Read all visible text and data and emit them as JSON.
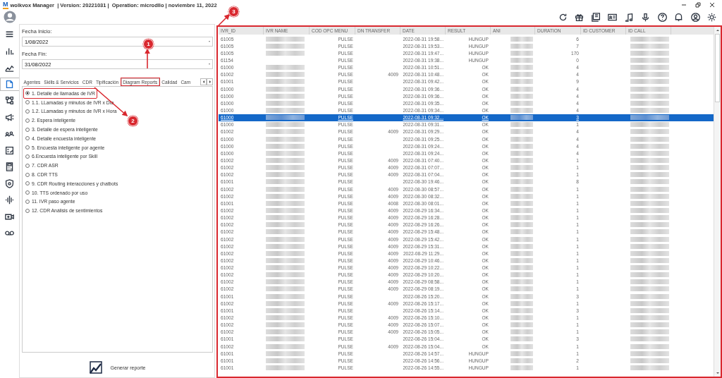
{
  "window": {
    "logo": "M",
    "title": "wolkvox Manager  | Version: 20221031 |  Operation: microdllo | noviembre 11, 2022"
  },
  "sidebar": {
    "items": [
      {
        "selected": false
      },
      {
        "selected": false
      },
      {
        "selected": false
      },
      {
        "selected": true
      },
      {
        "selected": false
      },
      {
        "selected": false
      },
      {
        "selected": false
      },
      {
        "selected": false
      },
      {
        "selected": false
      },
      {
        "selected": false
      },
      {
        "selected": false
      },
      {
        "selected": false
      },
      {
        "selected": false
      }
    ]
  },
  "filters": {
    "start_label": "Fecha Inicio:",
    "start_value": "1/08/2022",
    "end_label": "Fecha Fin:",
    "end_value": "31/08/2022"
  },
  "tabs": [
    {
      "label": "Agentes",
      "selected": false,
      "annotated": false
    },
    {
      "label": "Skills & Servicios",
      "selected": false,
      "annotated": false
    },
    {
      "label": "CDR",
      "selected": false,
      "annotated": false
    },
    {
      "label": "Tipificación",
      "selected": false,
      "annotated": false
    },
    {
      "label": "Diagram Reports",
      "selected": true,
      "annotated": true
    },
    {
      "label": "Calidad",
      "selected": false,
      "annotated": false
    },
    {
      "label": "Cam",
      "selected": false,
      "annotated": false
    }
  ],
  "reports": [
    {
      "label": "1. Detalle de llamadas de IVR",
      "selected": true,
      "annotated": true
    },
    {
      "label": "1.1. LLamadas y minutos de IVR x Día",
      "selected": false,
      "annotated": false
    },
    {
      "label": "1.2. LLamadas y minutos de IVR x Hora",
      "selected": false,
      "annotated": false
    },
    {
      "label": "2. Espera inteligente",
      "selected": false,
      "annotated": false
    },
    {
      "label": "3. Detalle de espera inteligente",
      "selected": false,
      "annotated": false
    },
    {
      "label": "4. Detalle encuesta inteligente",
      "selected": false,
      "annotated": false
    },
    {
      "label": "5. Encuesta inteligente por agente",
      "selected": false,
      "annotated": false
    },
    {
      "label": "6.Encuesta inteligente por Skill",
      "selected": false,
      "annotated": false
    },
    {
      "label": "7. CDR ASR",
      "selected": false,
      "annotated": false
    },
    {
      "label": "8. CDR TTS",
      "selected": false,
      "annotated": false
    },
    {
      "label": "9. CDR Routing interacciones y chatbots",
      "selected": false,
      "annotated": false
    },
    {
      "label": "10. TTS ordenado por uso",
      "selected": false,
      "annotated": false
    },
    {
      "label": "11. IVR paso agente",
      "selected": false,
      "annotated": false
    },
    {
      "label": "12. CDR Análisis de sentimientos",
      "selected": false,
      "annotated": false
    }
  ],
  "generate_button": {
    "label": "Generar reporte"
  },
  "table": {
    "annotated": true,
    "columns": [
      "IVR_ID",
      "IVR NAME",
      "COD OPC MENU",
      "DN TRANSFER",
      "DATE",
      "RESULT",
      "ANI",
      "DURATION",
      "ID CUSTOMER",
      "ID CALL"
    ],
    "rows": [
      {
        "ivr_id": "61005",
        "ivr_name_blurred": true,
        "cod_opc_menu": "PULSE",
        "date": "2022-08-31 19:58...",
        "result": "HUNGUP",
        "duration": "6",
        "selected": false
      },
      {
        "ivr_id": "61005",
        "ivr_name_blurred": true,
        "cod_opc_menu": "PULSE",
        "date": "2022-08-31 19:53...",
        "result": "HUNGUP",
        "duration": "7",
        "selected": false
      },
      {
        "ivr_id": "61005",
        "ivr_name_blurred": true,
        "cod_opc_menu": "PULSE",
        "date": "2022-08-31 19:47...",
        "result": "HUNGUP",
        "duration": "170",
        "selected": false
      },
      {
        "ivr_id": "61154",
        "ivr_name_blurred": false,
        "cod_opc_menu": "PULSE",
        "date": "2022-08-31 19:38...",
        "result": "HUNGUP",
        "duration": "0",
        "selected": false
      },
      {
        "ivr_id": "61000",
        "ivr_name_blurred": true,
        "cod_opc_menu": "PULSE",
        "date": "2022-08-31 10:51...",
        "result": "OK",
        "duration": "4",
        "selected": false
      },
      {
        "ivr_id": "61002",
        "ivr_name_blurred": true,
        "cod_opc_menu": "PULSE",
        "dn_transfer": "4009",
        "date": "2022-08-31 10:48...",
        "result": "OK",
        "duration": "4",
        "selected": false
      },
      {
        "ivr_id": "61001",
        "ivr_name_blurred": true,
        "cod_opc_menu": "PULSE",
        "date": "2022-08-31 09:42...",
        "result": "OK",
        "duration": "9",
        "selected": false
      },
      {
        "ivr_id": "61000",
        "ivr_name_blurred": true,
        "cod_opc_menu": "PULSE",
        "date": "2022-08-31 09:36...",
        "result": "OK",
        "duration": "4",
        "selected": false
      },
      {
        "ivr_id": "61000",
        "ivr_name_blurred": true,
        "cod_opc_menu": "PULSE",
        "date": "2022-08-31 09:36...",
        "result": "OK",
        "duration": "4",
        "selected": false
      },
      {
        "ivr_id": "61000",
        "ivr_name_blurred": true,
        "cod_opc_menu": "PULSE",
        "date": "2022-08-31 09:35...",
        "result": "OK",
        "duration": "4",
        "selected": false
      },
      {
        "ivr_id": "61000",
        "ivr_name_blurred": true,
        "cod_opc_menu": "PULSE",
        "date": "2022-08-31 09:34...",
        "result": "OK",
        "duration": "4",
        "selected": false
      },
      {
        "ivr_id": "61000",
        "ivr_name_blurred": true,
        "cod_opc_menu": "PULSE",
        "date": "2022-08-31 09:32...",
        "result": "OK",
        "duration": "3",
        "selected": true
      },
      {
        "ivr_id": "61000",
        "ivr_name_blurred": true,
        "cod_opc_menu": "PULSE",
        "date": "2022-08-31 09:31...",
        "result": "OK",
        "duration": "1",
        "selected": false
      },
      {
        "ivr_id": "61002",
        "ivr_name_blurred": true,
        "cod_opc_menu": "PULSE",
        "dn_transfer": "4009",
        "date": "2022-08-31 09:29...",
        "result": "OK",
        "duration": "4",
        "selected": false
      },
      {
        "ivr_id": "61000",
        "ivr_name_blurred": true,
        "cod_opc_menu": "PULSE",
        "date": "2022-08-31 09:25...",
        "result": "OK",
        "duration": "4",
        "selected": false
      },
      {
        "ivr_id": "61000",
        "ivr_name_blurred": true,
        "cod_opc_menu": "PULSE",
        "date": "2022-08-31 09:24...",
        "result": "OK",
        "duration": "4",
        "selected": false
      },
      {
        "ivr_id": "61000",
        "ivr_name_blurred": true,
        "cod_opc_menu": "PULSE",
        "date": "2022-08-31 09:24...",
        "result": "OK",
        "duration": "4",
        "selected": false
      },
      {
        "ivr_id": "61002",
        "ivr_name_blurred": true,
        "cod_opc_menu": "PULSE",
        "dn_transfer": "4009",
        "date": "2022-08-31 07:40...",
        "result": "OK",
        "duration": "1",
        "selected": false
      },
      {
        "ivr_id": "61002",
        "ivr_name_blurred": true,
        "cod_opc_menu": "PULSE",
        "dn_transfer": "4009",
        "date": "2022-08-31 07:07...",
        "result": "OK",
        "duration": "1",
        "selected": false
      },
      {
        "ivr_id": "61002",
        "ivr_name_blurred": true,
        "cod_opc_menu": "PULSE",
        "dn_transfer": "4009",
        "date": "2022-08-31 07:04...",
        "result": "OK",
        "duration": "1",
        "selected": false
      },
      {
        "ivr_id": "61001",
        "ivr_name_blurred": true,
        "cod_opc_menu": "PULSE",
        "date": "2022-08-30 19:46...",
        "result": "OK",
        "duration": "8",
        "selected": false
      },
      {
        "ivr_id": "61002",
        "ivr_name_blurred": true,
        "cod_opc_menu": "PULSE",
        "dn_transfer": "4009",
        "date": "2022-08-30 08:57...",
        "result": "OK",
        "duration": "1",
        "selected": false
      },
      {
        "ivr_id": "61002",
        "ivr_name_blurred": true,
        "cod_opc_menu": "PULSE",
        "dn_transfer": "4009",
        "date": "2022-08-30 08:32...",
        "result": "OK",
        "duration": "1",
        "selected": false
      },
      {
        "ivr_id": "61001",
        "ivr_name_blurred": true,
        "cod_opc_menu": "PULSE",
        "dn_transfer": "4008",
        "date": "2022-08-30 08:01...",
        "result": "OK",
        "duration": "1",
        "selected": false
      },
      {
        "ivr_id": "61002",
        "ivr_name_blurred": true,
        "cod_opc_menu": "PULSE",
        "dn_transfer": "4009",
        "date": "2022-08-29 16:34...",
        "result": "OK",
        "duration": "1",
        "selected": false
      },
      {
        "ivr_id": "61002",
        "ivr_name_blurred": true,
        "cod_opc_menu": "PULSE",
        "dn_transfer": "4009",
        "date": "2022-08-29 16:28...",
        "result": "OK",
        "duration": "1",
        "selected": false
      },
      {
        "ivr_id": "61002",
        "ivr_name_blurred": true,
        "cod_opc_menu": "PULSE",
        "dn_transfer": "4009",
        "date": "2022-08-29 16:26...",
        "result": "OK",
        "duration": "1",
        "selected": false
      },
      {
        "ivr_id": "61002",
        "ivr_name_blurred": true,
        "cod_opc_menu": "PULSE",
        "dn_transfer": "4009",
        "date": "2022-08-29 15:48...",
        "result": "OK",
        "duration": "1",
        "selected": false
      },
      {
        "ivr_id": "61002",
        "ivr_name_blurred": true,
        "cod_opc_menu": "PULSE",
        "dn_transfer": "4009",
        "date": "2022-08-29 15:42...",
        "result": "OK",
        "duration": "1",
        "selected": false
      },
      {
        "ivr_id": "61002",
        "ivr_name_blurred": true,
        "cod_opc_menu": "PULSE",
        "dn_transfer": "4009",
        "date": "2022-08-29 15:31...",
        "result": "OK",
        "duration": "1",
        "selected": false
      },
      {
        "ivr_id": "61002",
        "ivr_name_blurred": true,
        "cod_opc_menu": "PULSE",
        "dn_transfer": "4009",
        "date": "2022-08-29 11:29...",
        "result": "OK",
        "duration": "1",
        "selected": false
      },
      {
        "ivr_id": "61002",
        "ivr_name_blurred": true,
        "cod_opc_menu": "PULSE",
        "dn_transfer": "4009",
        "date": "2022-08-29 10:46...",
        "result": "OK",
        "duration": "1",
        "selected": false
      },
      {
        "ivr_id": "61002",
        "ivr_name_blurred": true,
        "cod_opc_menu": "PULSE",
        "dn_transfer": "4009",
        "date": "2022-08-29 10:22...",
        "result": "OK",
        "duration": "1",
        "selected": false
      },
      {
        "ivr_id": "61002",
        "ivr_name_blurred": true,
        "cod_opc_menu": "PULSE",
        "dn_transfer": "4009",
        "date": "2022-08-29 10:20...",
        "result": "OK",
        "duration": "1",
        "selected": false
      },
      {
        "ivr_id": "61002",
        "ivr_name_blurred": true,
        "cod_opc_menu": "PULSE",
        "dn_transfer": "4009",
        "date": "2022-08-29 08:58...",
        "result": "OK",
        "duration": "1",
        "selected": false
      },
      {
        "ivr_id": "61002",
        "ivr_name_blurred": true,
        "cod_opc_menu": "PULSE",
        "dn_transfer": "4009",
        "date": "2022-08-29 08:19...",
        "result": "OK",
        "duration": "1",
        "selected": false
      },
      {
        "ivr_id": "61001",
        "ivr_name_blurred": true,
        "cod_opc_menu": "PULSE",
        "date": "2022-08-26 15:20...",
        "result": "OK",
        "duration": "3",
        "selected": false
      },
      {
        "ivr_id": "61002",
        "ivr_name_blurred": true,
        "cod_opc_menu": "PULSE",
        "dn_transfer": "4009",
        "date": "2022-08-26 15:17...",
        "result": "OK",
        "duration": "1",
        "selected": false
      },
      {
        "ivr_id": "61001",
        "ivr_name_blurred": true,
        "cod_opc_menu": "PULSE",
        "date": "2022-08-26 15:14...",
        "result": "OK",
        "duration": "3",
        "selected": false
      },
      {
        "ivr_id": "61002",
        "ivr_name_blurred": true,
        "cod_opc_menu": "PULSE",
        "dn_transfer": "4009",
        "date": "2022-08-26 15:10...",
        "result": "OK",
        "duration": "1",
        "selected": false
      },
      {
        "ivr_id": "61002",
        "ivr_name_blurred": true,
        "cod_opc_menu": "PULSE",
        "dn_transfer": "4009",
        "date": "2022-08-26 15:07...",
        "result": "OK",
        "duration": "1",
        "selected": false
      },
      {
        "ivr_id": "61002",
        "ivr_name_blurred": true,
        "cod_opc_menu": "PULSE",
        "dn_transfer": "4009",
        "date": "2022-08-26 15:05...",
        "result": "OK",
        "duration": "1",
        "selected": false
      },
      {
        "ivr_id": "61001",
        "ivr_name_blurred": true,
        "cod_opc_menu": "PULSE",
        "date": "2022-08-26 15:04...",
        "result": "OK",
        "duration": "3",
        "selected": false
      },
      {
        "ivr_id": "61002",
        "ivr_name_blurred": true,
        "cod_opc_menu": "PULSE",
        "dn_transfer": "4009",
        "date": "2022-08-26 15:04...",
        "result": "OK",
        "duration": "1",
        "selected": false
      },
      {
        "ivr_id": "61001",
        "ivr_name_blurred": true,
        "cod_opc_menu": "PULSE",
        "date": "2022-08-26 14:57...",
        "result": "HUNGUP",
        "duration": "1",
        "selected": false
      },
      {
        "ivr_id": "61001",
        "ivr_name_blurred": true,
        "cod_opc_menu": "PULSE",
        "date": "2022-08-26 14:56...",
        "result": "HUNGUP",
        "duration": "2",
        "selected": false
      },
      {
        "ivr_id": "61001",
        "ivr_name_blurred": true,
        "cod_opc_menu": "PULSE",
        "date": "2022-08-26 14:55...",
        "result": "HUNGUP",
        "duration": "1",
        "selected": false
      }
    ]
  },
  "annotations": [
    {
      "number": "1"
    },
    {
      "number": "2"
    },
    {
      "number": "3"
    }
  ]
}
